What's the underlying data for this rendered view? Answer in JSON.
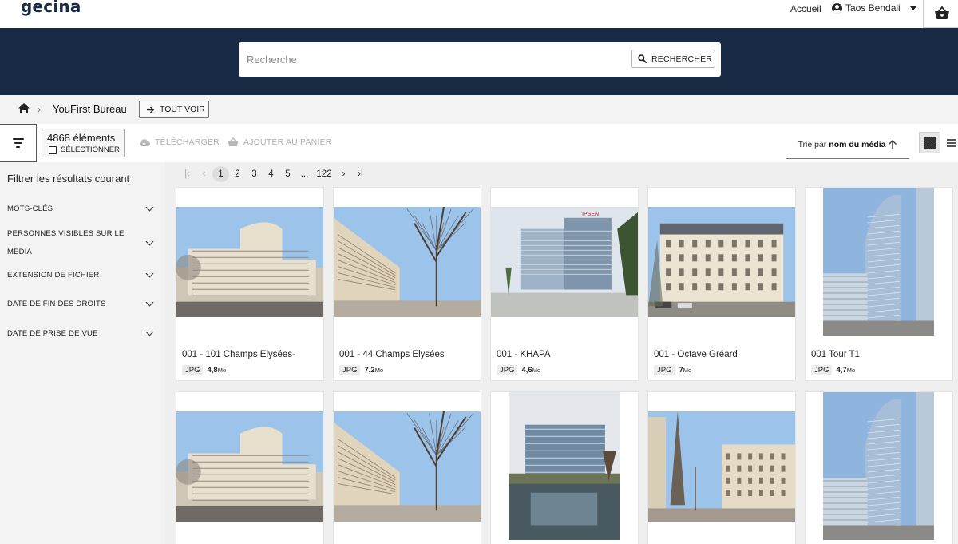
{
  "header": {
    "logo": "gecina",
    "nav_home": "Accueil",
    "user_name": "Taos Bendali",
    "icons": {
      "user": "user-circle-icon",
      "caret": "caret-down-icon",
      "cart": "basket-icon"
    }
  },
  "search": {
    "placeholder": "Recherche",
    "value": "",
    "button_label": "RECHERCHER",
    "icon": "search-icon"
  },
  "breadcrumb": {
    "home_icon": "home-icon",
    "current": "YouFirst Bureau",
    "see_all_label": "TOUT VOIR"
  },
  "toolbar": {
    "count": "4868 éléments",
    "select_all_label": "SÉLECTIONNER",
    "download_label": "TÉLÉCHARGER",
    "add_to_cart_label": "AJOUTER AU PANIER",
    "sort_prefix": "Trié par",
    "sort_field": "nom du média",
    "sort_direction": "ascending",
    "view_mode": "grid",
    "disabled_color": "#b0b0b0"
  },
  "filters": {
    "title": "Filtrer les résultats courant",
    "facets": [
      {
        "label_lines": [
          "MOTS-CLÉS"
        ]
      },
      {
        "label_lines": [
          "PERSONNES VISIBLES SUR LE",
          "MÉDIA"
        ]
      },
      {
        "label_lines": [
          "EXTENSION DE FICHIER"
        ]
      },
      {
        "label_lines": [
          "DATE DE FIN DES DROITS"
        ]
      },
      {
        "label_lines": [
          "DATE DE PRISE DE VUE"
        ]
      }
    ]
  },
  "pagination": {
    "pages": [
      "1",
      "2",
      "3",
      "4",
      "5",
      "...",
      "122"
    ],
    "current": "1"
  },
  "results": [
    {
      "title": "001 - 101 Champs Elysées-",
      "ext": "JPG",
      "size": "4,8",
      "unit": "Mo",
      "scene": "corner-building"
    },
    {
      "title": "001 - 44 Champs Elysées",
      "ext": "JPG",
      "size": "7,2",
      "unit": "Mo",
      "scene": "avenue-trees"
    },
    {
      "title": "001 - KHAPA",
      "ext": "JPG",
      "size": "4,6",
      "unit": "Mo",
      "scene": "glass-office",
      "sign": "IPSEN"
    },
    {
      "title": "001 - Octave Gréard",
      "ext": "JPG",
      "size": "7",
      "unit": "Mo",
      "scene": "haussmann"
    },
    {
      "title": "001 Tour T1",
      "ext": "JPG",
      "size": "4,7",
      "unit": "Mo",
      "scene": "tower"
    },
    {
      "title": "",
      "ext": "",
      "size": "",
      "unit": "",
      "scene": "corner-building"
    },
    {
      "title": "",
      "ext": "",
      "size": "",
      "unit": "",
      "scene": "avenue-trees"
    },
    {
      "title": "",
      "ext": "",
      "size": "",
      "unit": "",
      "scene": "glass-reflection"
    },
    {
      "title": "",
      "ext": "",
      "size": "",
      "unit": "",
      "scene": "eiffel-street"
    },
    {
      "title": "",
      "ext": "",
      "size": "",
      "unit": "",
      "scene": "tower"
    }
  ]
}
